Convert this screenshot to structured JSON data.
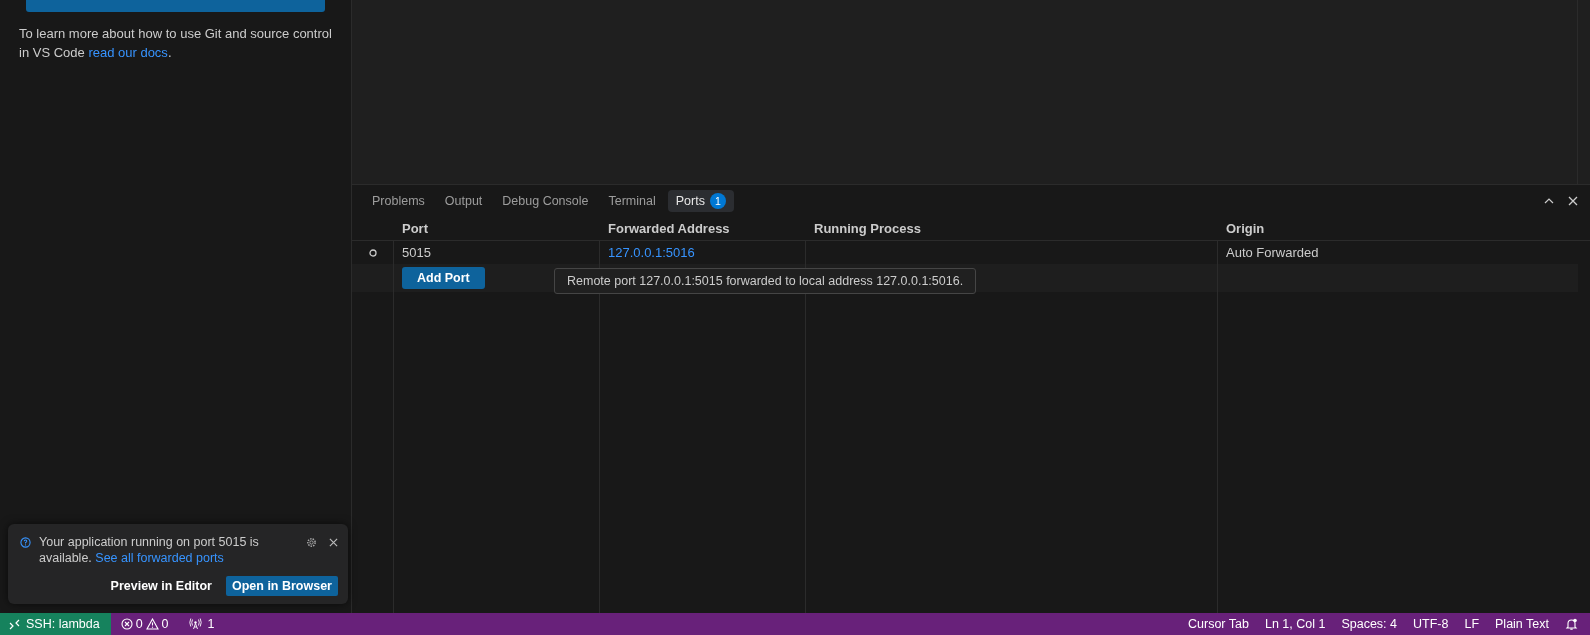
{
  "sidebar": {
    "help_text": "To learn more about how to use Git and source control in VS Code ",
    "help_link": "read our docs",
    "help_end": "."
  },
  "panel": {
    "tabs": [
      {
        "label": "Problems",
        "selected": false
      },
      {
        "label": "Output",
        "selected": false
      },
      {
        "label": "Debug Console",
        "selected": false
      },
      {
        "label": "Terminal",
        "selected": false
      },
      {
        "label": "Ports",
        "selected": true,
        "badge": "1"
      }
    ],
    "ports_table": {
      "columns": [
        "Port",
        "Forwarded Address",
        "Running Process",
        "Origin"
      ],
      "rows": [
        {
          "port": "5015",
          "address": "127.0.0.1:5016",
          "process": "",
          "origin": "Auto Forwarded"
        }
      ],
      "add_button": "Add Port"
    },
    "tooltip": "Remote port 127.0.0.1:5015 forwarded to local address 127.0.0.1:5016."
  },
  "notification": {
    "message": "Your application running on port 5015 is available. ",
    "link": "See all forwarded ports",
    "actions": [
      {
        "label": "Preview in Editor",
        "primary": false
      },
      {
        "label": "Open in Browser",
        "primary": true
      }
    ]
  },
  "status_bar": {
    "remote": "SSH: lambda",
    "errors": "0",
    "warnings": "0",
    "ports": "1",
    "right": [
      "Cursor Tab",
      "Ln 1, Col 1",
      "Spaces: 4",
      "UTF-8",
      "LF",
      "Plain Text"
    ]
  }
}
